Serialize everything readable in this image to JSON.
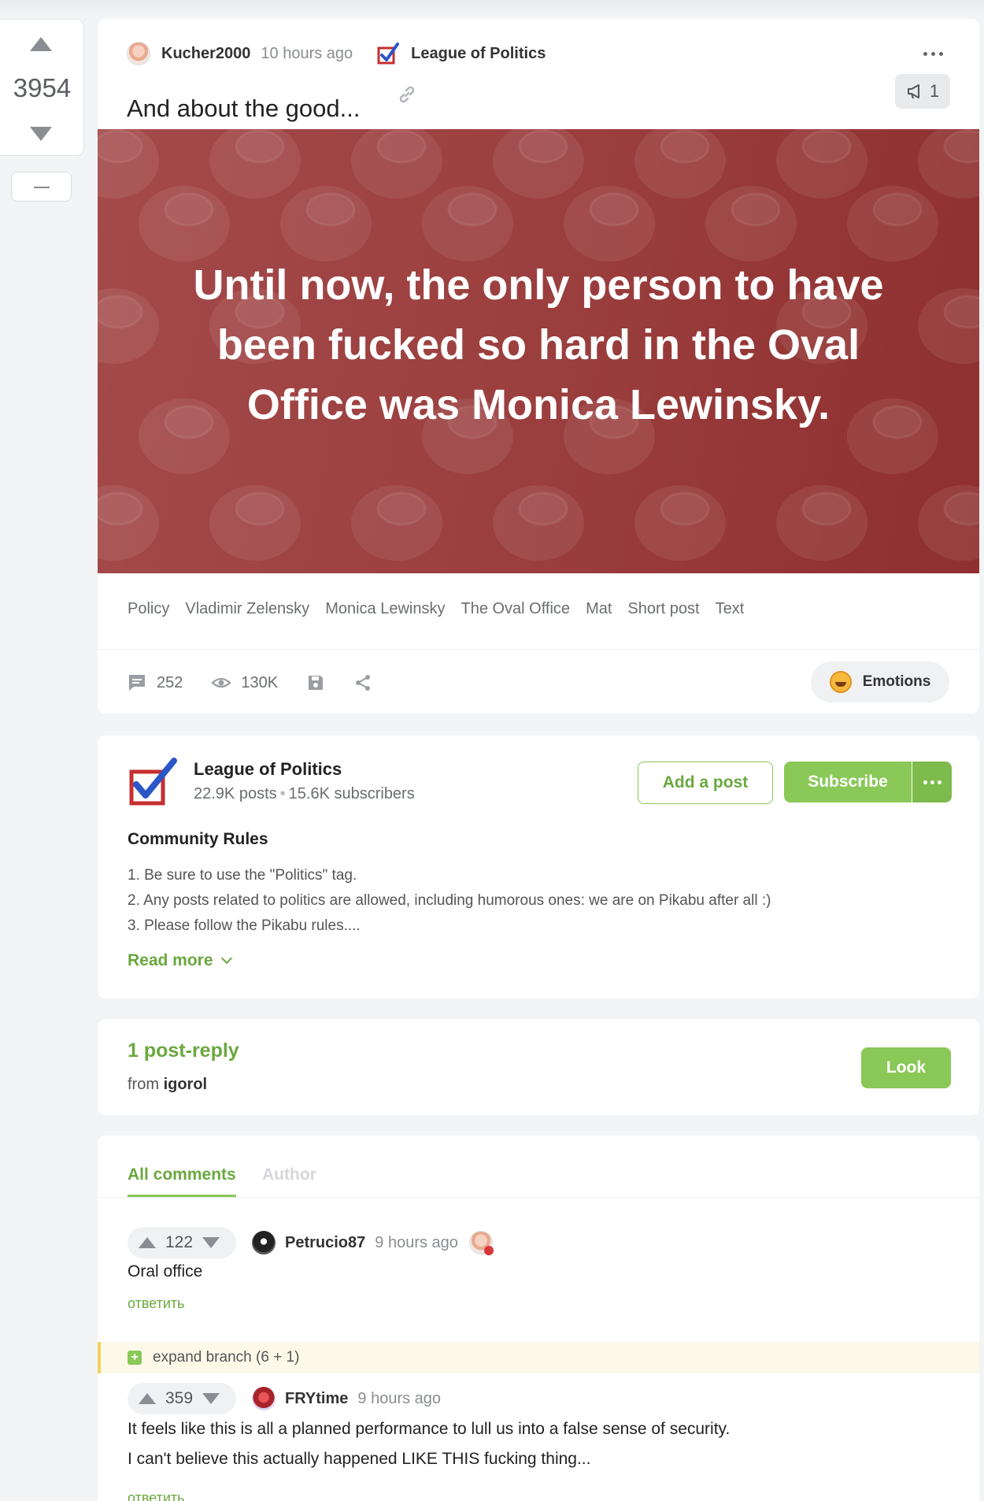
{
  "post": {
    "rating": "3954",
    "author": "Kucher2000",
    "time": "10 hours ago",
    "community": "League of Politics",
    "title": "And about the good...",
    "promo_count": "1",
    "banner_text": "Until now, the only person to have been fucked so hard in the Oval Office was Monica Lewinsky.",
    "tags": [
      "Policy",
      "Vladimir Zelensky",
      "Monica Lewinsky",
      "The Oval Office",
      "Mat",
      "Short post",
      "Text"
    ],
    "comments_count": "252",
    "views": "130K",
    "emotions_label": "Emotions",
    "colors": {
      "banner": "#9a3d3d",
      "accent": "#8ac858"
    }
  },
  "community": {
    "name": "League of Politics",
    "posts": "22.9K posts",
    "subscribers": "15.6K subscribers",
    "add_post": "Add a post",
    "subscribe": "Subscribe",
    "rules_title": "Community Rules",
    "rules": [
      "1. Be sure to use the \"Politics\" tag.",
      "2. Any posts related to politics are allowed, including humorous ones: we are on Pikabu after all :)",
      "3. Please follow the Pikabu rules...."
    ],
    "read_more": "Read more"
  },
  "reply": {
    "title": "1 post-reply",
    "from_label": "from",
    "from_user": "igorol",
    "look": "Look"
  },
  "comments": {
    "tab_all": "All comments",
    "tab_author": "Author",
    "items": [
      {
        "rating": "122",
        "author": "Petrucio87",
        "time": "9 hours ago",
        "text": "Oral office",
        "reply": "ответить"
      },
      {
        "rating": "359",
        "author": "FRYtime",
        "time": "9 hours ago",
        "text1": "It feels like this is all a planned performance to lull us into a false sense of security.",
        "text2": "I can't believe this actually happened LIKE THIS fucking thing...",
        "reply": "ответить"
      }
    ],
    "expand_branch": "expand branch (6 + 1)"
  }
}
